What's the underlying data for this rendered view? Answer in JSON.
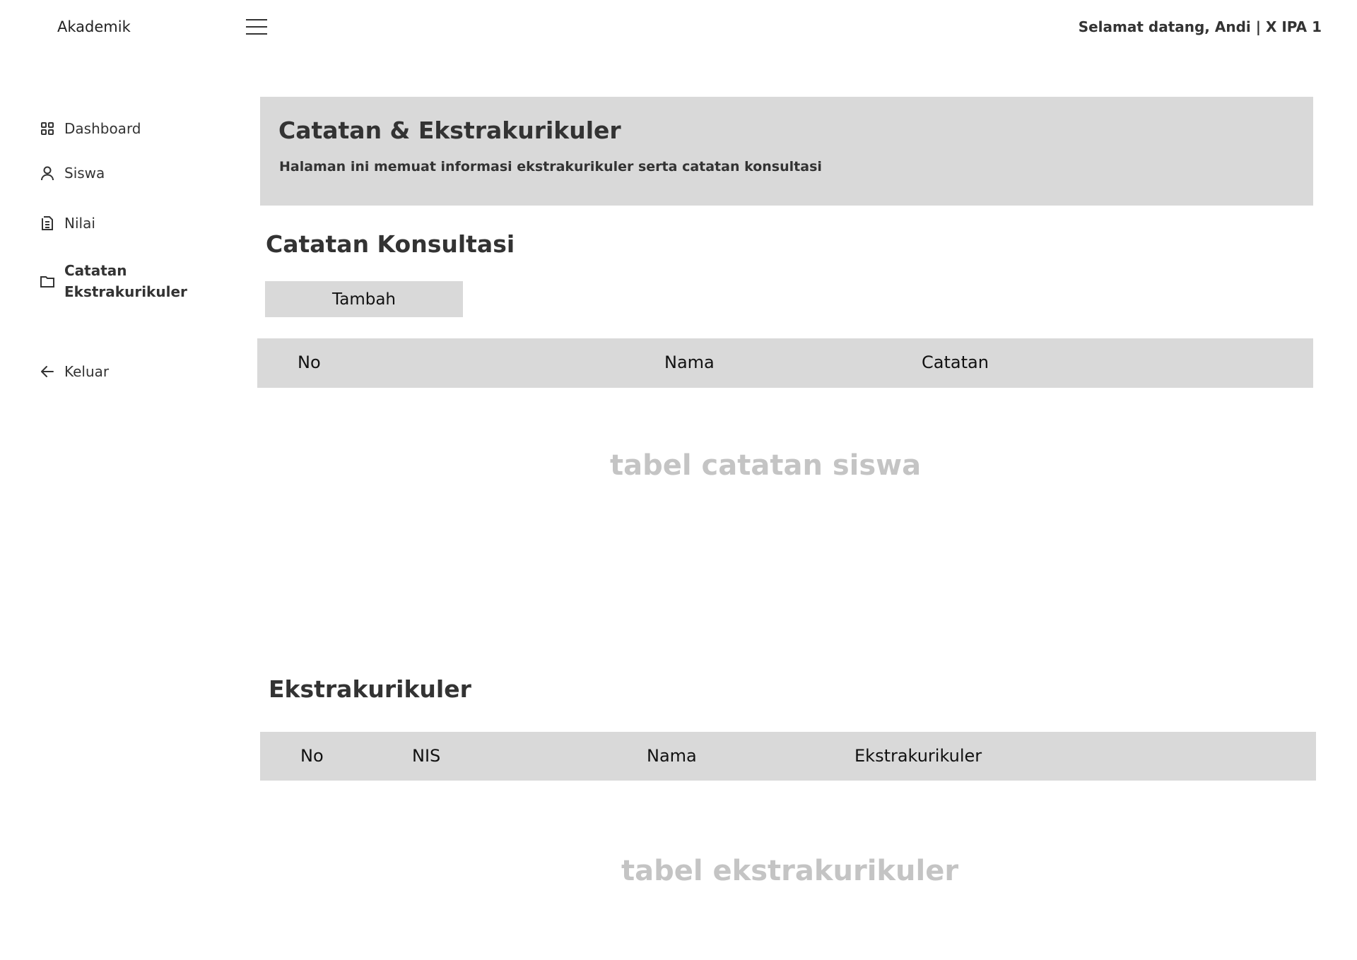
{
  "topbar": {
    "brand": "Akademik",
    "welcome": "Selamat  datang, Andi | X IPA  1"
  },
  "sidebar": {
    "items": [
      {
        "label": "Dashboard",
        "icon": "grid-icon"
      },
      {
        "label": "Siswa",
        "icon": "user-icon"
      },
      {
        "label": "Nilai",
        "icon": "document-icon"
      },
      {
        "label_line1": "Catatan",
        "label_line2": "Ekstrakurikuler",
        "icon": "folder-icon",
        "active": true
      },
      {
        "label": "Keluar",
        "icon": "arrow-left-icon"
      }
    ]
  },
  "header": {
    "title": "Catatan & Ekstrakurikuler",
    "subtitle": "Halaman ini memuat informasi ekstrakurikuler serta  catatan konsultasi"
  },
  "konsultasi": {
    "title": "Catatan Konsultasi",
    "add_button": "Tambah",
    "columns": [
      "No",
      "Nama",
      "Catatan"
    ],
    "placeholder": "tabel catatan siswa"
  },
  "ekstrakurikuler": {
    "title": "Ekstrakurikuler",
    "columns": [
      "No",
      "NIS",
      "Nama",
      "Ekstrakurikuler"
    ],
    "placeholder": "tabel ekstrakurikuler"
  },
  "colors": {
    "panel_bg": "#d9d9d9",
    "text": "#333333",
    "placeholder_text": "#c4c4c4"
  }
}
